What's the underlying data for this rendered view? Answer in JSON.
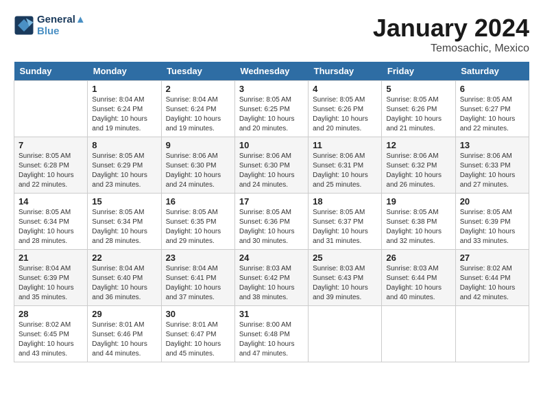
{
  "header": {
    "logo_line1": "General",
    "logo_line2": "Blue",
    "title": "January 2024",
    "subtitle": "Temosachic, Mexico"
  },
  "days_of_week": [
    "Sunday",
    "Monday",
    "Tuesday",
    "Wednesday",
    "Thursday",
    "Friday",
    "Saturday"
  ],
  "weeks": [
    [
      {
        "num": "",
        "info": ""
      },
      {
        "num": "1",
        "info": "Sunrise: 8:04 AM\nSunset: 6:24 PM\nDaylight: 10 hours\nand 19 minutes."
      },
      {
        "num": "2",
        "info": "Sunrise: 8:04 AM\nSunset: 6:24 PM\nDaylight: 10 hours\nand 19 minutes."
      },
      {
        "num": "3",
        "info": "Sunrise: 8:05 AM\nSunset: 6:25 PM\nDaylight: 10 hours\nand 20 minutes."
      },
      {
        "num": "4",
        "info": "Sunrise: 8:05 AM\nSunset: 6:26 PM\nDaylight: 10 hours\nand 20 minutes."
      },
      {
        "num": "5",
        "info": "Sunrise: 8:05 AM\nSunset: 6:26 PM\nDaylight: 10 hours\nand 21 minutes."
      },
      {
        "num": "6",
        "info": "Sunrise: 8:05 AM\nSunset: 6:27 PM\nDaylight: 10 hours\nand 22 minutes."
      }
    ],
    [
      {
        "num": "7",
        "info": "Sunrise: 8:05 AM\nSunset: 6:28 PM\nDaylight: 10 hours\nand 22 minutes."
      },
      {
        "num": "8",
        "info": "Sunrise: 8:05 AM\nSunset: 6:29 PM\nDaylight: 10 hours\nand 23 minutes."
      },
      {
        "num": "9",
        "info": "Sunrise: 8:06 AM\nSunset: 6:30 PM\nDaylight: 10 hours\nand 24 minutes."
      },
      {
        "num": "10",
        "info": "Sunrise: 8:06 AM\nSunset: 6:30 PM\nDaylight: 10 hours\nand 24 minutes."
      },
      {
        "num": "11",
        "info": "Sunrise: 8:06 AM\nSunset: 6:31 PM\nDaylight: 10 hours\nand 25 minutes."
      },
      {
        "num": "12",
        "info": "Sunrise: 8:06 AM\nSunset: 6:32 PM\nDaylight: 10 hours\nand 26 minutes."
      },
      {
        "num": "13",
        "info": "Sunrise: 8:06 AM\nSunset: 6:33 PM\nDaylight: 10 hours\nand 27 minutes."
      }
    ],
    [
      {
        "num": "14",
        "info": "Sunrise: 8:05 AM\nSunset: 6:34 PM\nDaylight: 10 hours\nand 28 minutes."
      },
      {
        "num": "15",
        "info": "Sunrise: 8:05 AM\nSunset: 6:34 PM\nDaylight: 10 hours\nand 28 minutes."
      },
      {
        "num": "16",
        "info": "Sunrise: 8:05 AM\nSunset: 6:35 PM\nDaylight: 10 hours\nand 29 minutes."
      },
      {
        "num": "17",
        "info": "Sunrise: 8:05 AM\nSunset: 6:36 PM\nDaylight: 10 hours\nand 30 minutes."
      },
      {
        "num": "18",
        "info": "Sunrise: 8:05 AM\nSunset: 6:37 PM\nDaylight: 10 hours\nand 31 minutes."
      },
      {
        "num": "19",
        "info": "Sunrise: 8:05 AM\nSunset: 6:38 PM\nDaylight: 10 hours\nand 32 minutes."
      },
      {
        "num": "20",
        "info": "Sunrise: 8:05 AM\nSunset: 6:39 PM\nDaylight: 10 hours\nand 33 minutes."
      }
    ],
    [
      {
        "num": "21",
        "info": "Sunrise: 8:04 AM\nSunset: 6:39 PM\nDaylight: 10 hours\nand 35 minutes."
      },
      {
        "num": "22",
        "info": "Sunrise: 8:04 AM\nSunset: 6:40 PM\nDaylight: 10 hours\nand 36 minutes."
      },
      {
        "num": "23",
        "info": "Sunrise: 8:04 AM\nSunset: 6:41 PM\nDaylight: 10 hours\nand 37 minutes."
      },
      {
        "num": "24",
        "info": "Sunrise: 8:03 AM\nSunset: 6:42 PM\nDaylight: 10 hours\nand 38 minutes."
      },
      {
        "num": "25",
        "info": "Sunrise: 8:03 AM\nSunset: 6:43 PM\nDaylight: 10 hours\nand 39 minutes."
      },
      {
        "num": "26",
        "info": "Sunrise: 8:03 AM\nSunset: 6:44 PM\nDaylight: 10 hours\nand 40 minutes."
      },
      {
        "num": "27",
        "info": "Sunrise: 8:02 AM\nSunset: 6:44 PM\nDaylight: 10 hours\nand 42 minutes."
      }
    ],
    [
      {
        "num": "28",
        "info": "Sunrise: 8:02 AM\nSunset: 6:45 PM\nDaylight: 10 hours\nand 43 minutes."
      },
      {
        "num": "29",
        "info": "Sunrise: 8:01 AM\nSunset: 6:46 PM\nDaylight: 10 hours\nand 44 minutes."
      },
      {
        "num": "30",
        "info": "Sunrise: 8:01 AM\nSunset: 6:47 PM\nDaylight: 10 hours\nand 45 minutes."
      },
      {
        "num": "31",
        "info": "Sunrise: 8:00 AM\nSunset: 6:48 PM\nDaylight: 10 hours\nand 47 minutes."
      },
      {
        "num": "",
        "info": ""
      },
      {
        "num": "",
        "info": ""
      },
      {
        "num": "",
        "info": ""
      }
    ]
  ]
}
